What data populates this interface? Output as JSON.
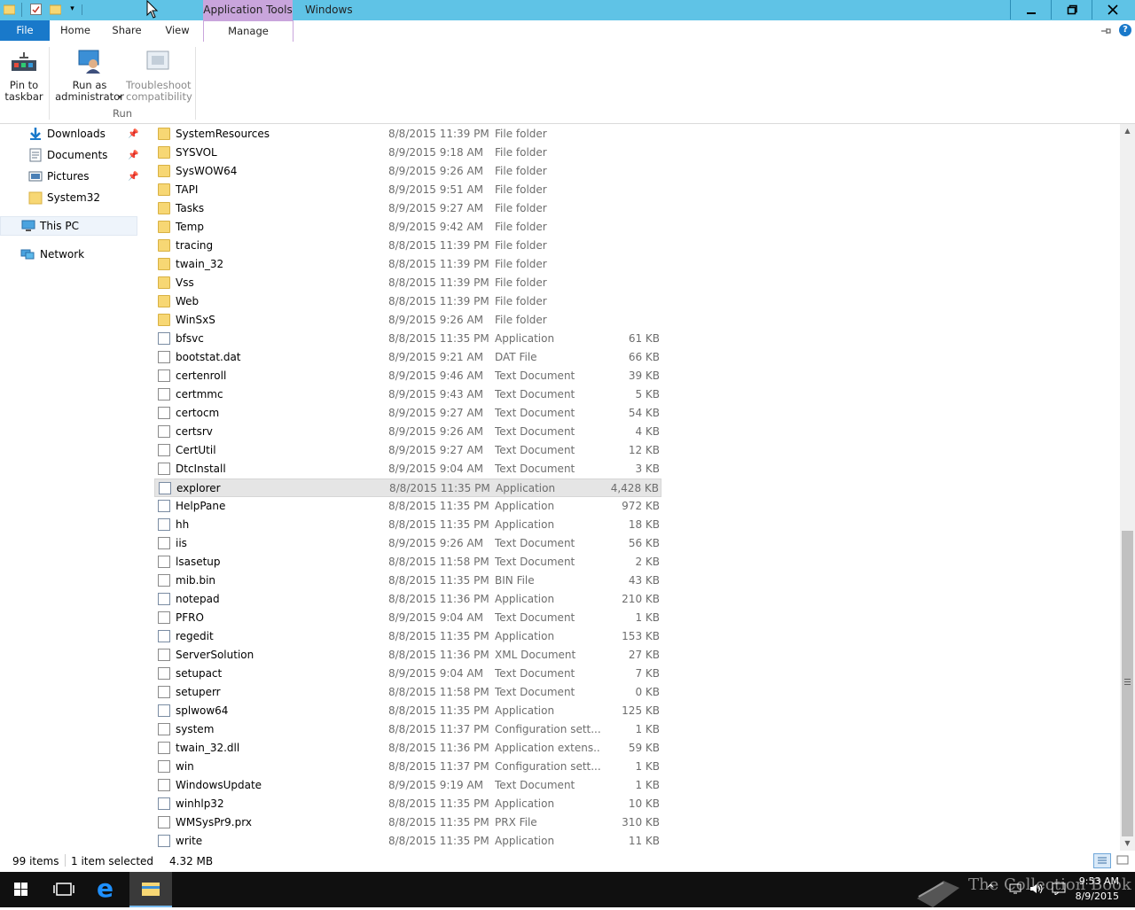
{
  "window": {
    "title": "Windows",
    "context_tab_header": "Application Tools",
    "controls": {
      "minimize": "—",
      "restore": "❐",
      "close": "✕"
    }
  },
  "ribbon": {
    "tabs": [
      "File",
      "Home",
      "Share",
      "View",
      "Manage"
    ],
    "buttons": {
      "pin_line1": "Pin to",
      "pin_line2": "taskbar",
      "runas_line1": "Run as",
      "runas_line2": "administrator",
      "trouble_line1": "Troubleshoot",
      "trouble_line2": "compatibility"
    },
    "group": "Run",
    "help": "?"
  },
  "nav": {
    "quick": [
      {
        "label": "Downloads",
        "icon": "download-icon"
      },
      {
        "label": "Documents",
        "icon": "documents-icon"
      },
      {
        "label": "Pictures",
        "icon": "pictures-icon"
      },
      {
        "label": "System32",
        "icon": "folder-icon"
      }
    ],
    "this_pc": "This PC",
    "network": "Network"
  },
  "files": [
    {
      "name": "SystemResources",
      "date": "8/8/2015 11:39 PM",
      "type": "File folder",
      "size": "",
      "kind": "folder"
    },
    {
      "name": "SYSVOL",
      "date": "8/9/2015 9:18 AM",
      "type": "File folder",
      "size": "",
      "kind": "folder"
    },
    {
      "name": "SysWOW64",
      "date": "8/9/2015 9:26 AM",
      "type": "File folder",
      "size": "",
      "kind": "folder"
    },
    {
      "name": "TAPI",
      "date": "8/9/2015 9:51 AM",
      "type": "File folder",
      "size": "",
      "kind": "folder"
    },
    {
      "name": "Tasks",
      "date": "8/9/2015 9:27 AM",
      "type": "File folder",
      "size": "",
      "kind": "folder"
    },
    {
      "name": "Temp",
      "date": "8/9/2015 9:42 AM",
      "type": "File folder",
      "size": "",
      "kind": "folder"
    },
    {
      "name": "tracing",
      "date": "8/8/2015 11:39 PM",
      "type": "File folder",
      "size": "",
      "kind": "folder"
    },
    {
      "name": "twain_32",
      "date": "8/8/2015 11:39 PM",
      "type": "File folder",
      "size": "",
      "kind": "folder"
    },
    {
      "name": "Vss",
      "date": "8/8/2015 11:39 PM",
      "type": "File folder",
      "size": "",
      "kind": "folder"
    },
    {
      "name": "Web",
      "date": "8/8/2015 11:39 PM",
      "type": "File folder",
      "size": "",
      "kind": "folder"
    },
    {
      "name": "WinSxS",
      "date": "8/9/2015 9:26 AM",
      "type": "File folder",
      "size": "",
      "kind": "folder"
    },
    {
      "name": "bfsvc",
      "date": "8/8/2015 11:35 PM",
      "type": "Application",
      "size": "61 KB",
      "kind": "app"
    },
    {
      "name": "bootstat.dat",
      "date": "8/9/2015 9:21 AM",
      "type": "DAT File",
      "size": "66 KB",
      "kind": "doc"
    },
    {
      "name": "certenroll",
      "date": "8/9/2015 9:46 AM",
      "type": "Text Document",
      "size": "39 KB",
      "kind": "doc"
    },
    {
      "name": "certmmc",
      "date": "8/9/2015 9:43 AM",
      "type": "Text Document",
      "size": "5 KB",
      "kind": "doc"
    },
    {
      "name": "certocm",
      "date": "8/9/2015 9:27 AM",
      "type": "Text Document",
      "size": "54 KB",
      "kind": "doc"
    },
    {
      "name": "certsrv",
      "date": "8/9/2015 9:26 AM",
      "type": "Text Document",
      "size": "4 KB",
      "kind": "doc"
    },
    {
      "name": "CertUtil",
      "date": "8/9/2015 9:27 AM",
      "type": "Text Document",
      "size": "12 KB",
      "kind": "doc"
    },
    {
      "name": "DtcInstall",
      "date": "8/9/2015 9:04 AM",
      "type": "Text Document",
      "size": "3 KB",
      "kind": "doc"
    },
    {
      "name": "explorer",
      "date": "8/8/2015 11:35 PM",
      "type": "Application",
      "size": "4,428 KB",
      "kind": "app",
      "selected": true
    },
    {
      "name": "HelpPane",
      "date": "8/8/2015 11:35 PM",
      "type": "Application",
      "size": "972 KB",
      "kind": "app"
    },
    {
      "name": "hh",
      "date": "8/8/2015 11:35 PM",
      "type": "Application",
      "size": "18 KB",
      "kind": "app"
    },
    {
      "name": "iis",
      "date": "8/9/2015 9:26 AM",
      "type": "Text Document",
      "size": "56 KB",
      "kind": "doc"
    },
    {
      "name": "lsasetup",
      "date": "8/8/2015 11:58 PM",
      "type": "Text Document",
      "size": "2 KB",
      "kind": "doc"
    },
    {
      "name": "mib.bin",
      "date": "8/8/2015 11:35 PM",
      "type": "BIN File",
      "size": "43 KB",
      "kind": "doc"
    },
    {
      "name": "notepad",
      "date": "8/8/2015 11:36 PM",
      "type": "Application",
      "size": "210 KB",
      "kind": "app"
    },
    {
      "name": "PFRO",
      "date": "8/9/2015 9:04 AM",
      "type": "Text Document",
      "size": "1 KB",
      "kind": "doc"
    },
    {
      "name": "regedit",
      "date": "8/8/2015 11:35 PM",
      "type": "Application",
      "size": "153 KB",
      "kind": "app"
    },
    {
      "name": "ServerSolution",
      "date": "8/8/2015 11:36 PM",
      "type": "XML Document",
      "size": "27 KB",
      "kind": "doc"
    },
    {
      "name": "setupact",
      "date": "8/9/2015 9:04 AM",
      "type": "Text Document",
      "size": "7 KB",
      "kind": "doc"
    },
    {
      "name": "setuperr",
      "date": "8/8/2015 11:58 PM",
      "type": "Text Document",
      "size": "0 KB",
      "kind": "doc"
    },
    {
      "name": "splwow64",
      "date": "8/8/2015 11:35 PM",
      "type": "Application",
      "size": "125 KB",
      "kind": "app"
    },
    {
      "name": "system",
      "date": "8/8/2015 11:37 PM",
      "type": "Configuration sett...",
      "size": "1 KB",
      "kind": "doc"
    },
    {
      "name": "twain_32.dll",
      "date": "8/8/2015 11:36 PM",
      "type": "Application extens...",
      "size": "59 KB",
      "kind": "doc"
    },
    {
      "name": "win",
      "date": "8/8/2015 11:37 PM",
      "type": "Configuration sett...",
      "size": "1 KB",
      "kind": "doc"
    },
    {
      "name": "WindowsUpdate",
      "date": "8/9/2015 9:19 AM",
      "type": "Text Document",
      "size": "1 KB",
      "kind": "doc"
    },
    {
      "name": "winhlp32",
      "date": "8/8/2015 11:35 PM",
      "type": "Application",
      "size": "10 KB",
      "kind": "app"
    },
    {
      "name": "WMSysPr9.prx",
      "date": "8/8/2015 11:35 PM",
      "type": "PRX File",
      "size": "310 KB",
      "kind": "doc"
    },
    {
      "name": "write",
      "date": "8/8/2015 11:35 PM",
      "type": "Application",
      "size": "11 KB",
      "kind": "app"
    }
  ],
  "status": {
    "items": "99 items",
    "selected": "1 item selected",
    "size": "4.32 MB"
  },
  "taskbar": {
    "time": "9:53 AM",
    "date": "8/9/2015",
    "watermark": "The Collection Book"
  },
  "colors": {
    "titlebar": "#5fc3e6",
    "context_tab": "#c9a5dc",
    "file_tab": "#1979ca",
    "taskbar": "#101010"
  }
}
